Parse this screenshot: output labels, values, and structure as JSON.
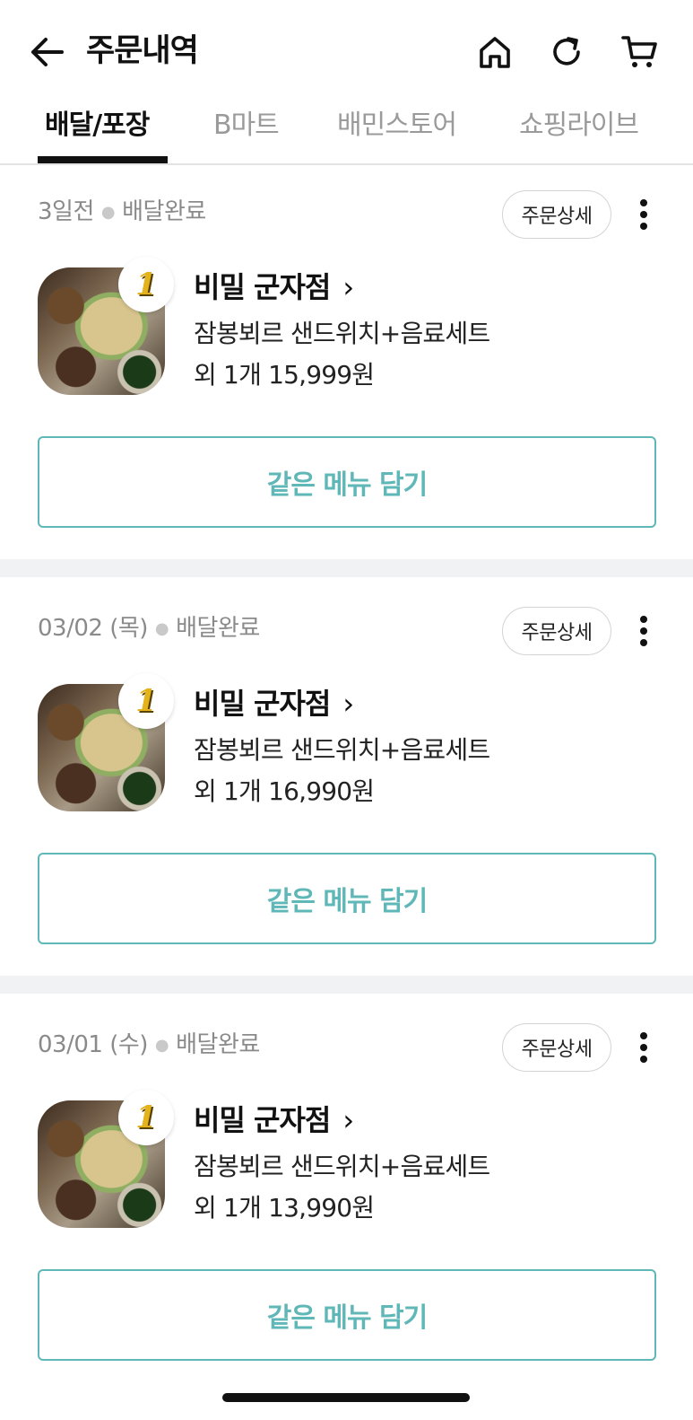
{
  "header": {
    "title": "주문내역"
  },
  "tabs": [
    {
      "label": "배달/포장",
      "active": true
    },
    {
      "label": "B마트",
      "active": false
    },
    {
      "label": "배민스토어",
      "active": false
    },
    {
      "label": "쇼핑라이브",
      "active": false
    }
  ],
  "orders": [
    {
      "date": "3일전",
      "status": "배달완료",
      "detail_label": "주문상세",
      "badge": "1",
      "store": "비밀 군자점",
      "chevron": "›",
      "menu": "잠봉뵈르 샌드위치+음료세트",
      "price_line": "외 1개 15,999원",
      "reorder_label": "같은 메뉴 담기"
    },
    {
      "date": "03/02 (목)",
      "status": "배달완료",
      "detail_label": "주문상세",
      "badge": "1",
      "store": "비밀 군자점",
      "chevron": "›",
      "menu": "잠봉뵈르 샌드위치+음료세트",
      "price_line": "외 1개 16,990원",
      "reorder_label": "같은 메뉴 담기"
    },
    {
      "date": "03/01 (수)",
      "status": "배달완료",
      "detail_label": "주문상세",
      "badge": "1",
      "store": "비밀 군자점",
      "chevron": "›",
      "menu": "잠봉뵈르 샌드위치+음료세트",
      "price_line": "외 1개 13,990원",
      "reorder_label": "같은 메뉴 담기"
    }
  ],
  "icons": {
    "back": "arrow-left-icon",
    "home": "home-icon",
    "refresh": "refresh-icon",
    "cart": "cart-icon",
    "more": "more-vertical-icon"
  },
  "colors": {
    "accent": "#5fb8b7",
    "separator": "#f1f2f4",
    "muted_text": "#8a8a8a"
  }
}
